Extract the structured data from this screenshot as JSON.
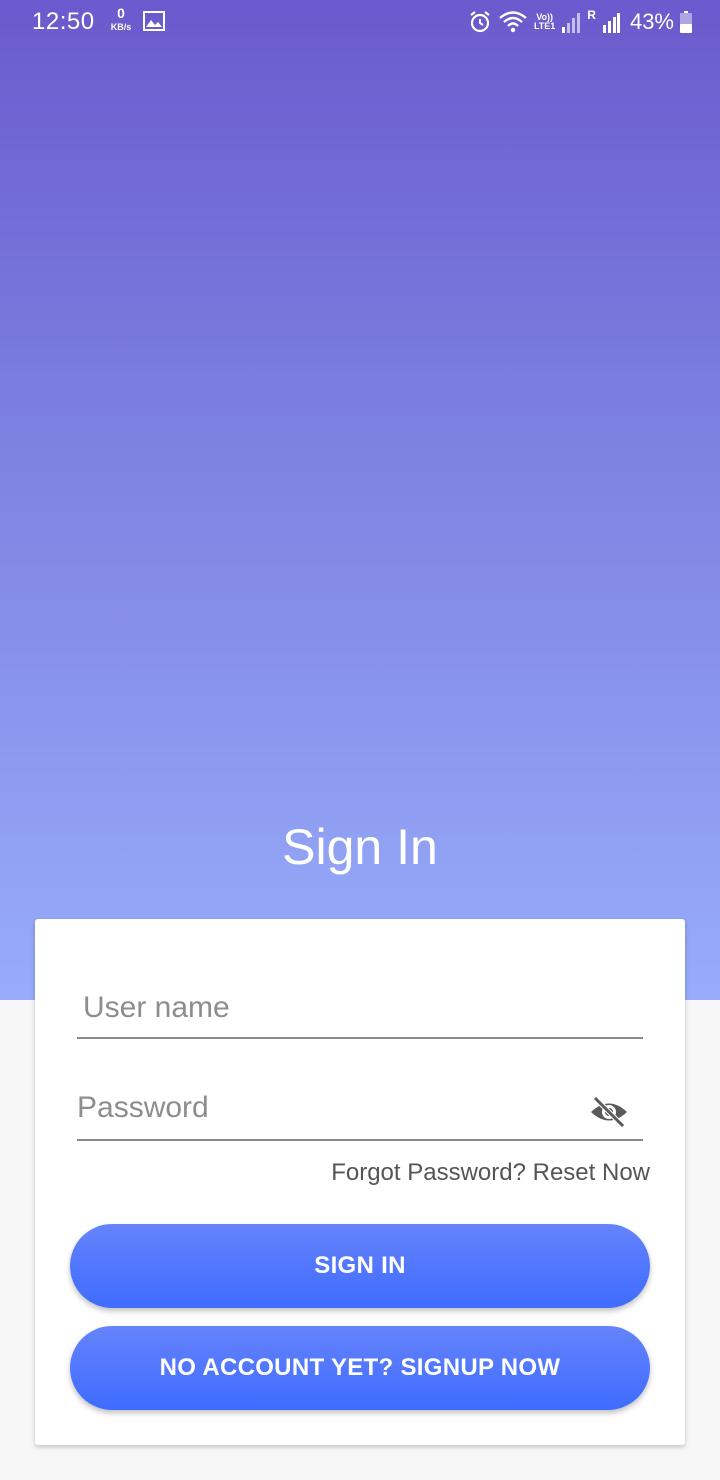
{
  "status_bar": {
    "time": "12:50",
    "net_speed_value": "0",
    "net_speed_unit": "KB/s",
    "lte_top": "Vo))",
    "lte_bottom": "LTE1",
    "roaming": "R",
    "battery": "43%"
  },
  "screen": {
    "title": "Sign In"
  },
  "form": {
    "username_placeholder": "User name",
    "username_value": "",
    "password_placeholder": "Password",
    "password_value": "",
    "forgot_link": "Forgot Password? Reset Now",
    "signin_button": "SIGN IN",
    "signup_button": "NO ACCOUNT YET? SIGNUP NOW"
  },
  "icons": {
    "password_toggle": "eye-off-icon",
    "alarm": "alarm-icon",
    "wifi": "wifi-icon",
    "gallery": "image-icon"
  },
  "colors": {
    "gradient_top": "#6a5acd",
    "gradient_bottom": "#98acfa",
    "button": "#4a73ff"
  }
}
